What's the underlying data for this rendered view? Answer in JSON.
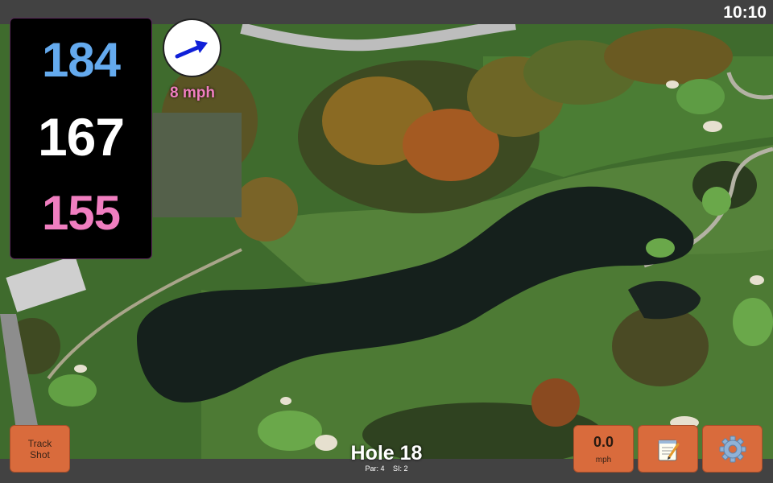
{
  "status": {
    "time": "10:10"
  },
  "distances": {
    "back": "184",
    "middle": "167",
    "front": "155"
  },
  "wind": {
    "speed": "8 mph",
    "icon": "arrow-northeast-icon"
  },
  "buttons": {
    "track_line1": "Track",
    "track_line2": "Shot",
    "speed_value": "0.0",
    "speed_unit": "mph",
    "notes_icon": "notepad-icon",
    "settings_icon": "gear-icon"
  },
  "hole": {
    "title": "Hole 18",
    "par": "Par: 4",
    "si": "SI: 2"
  },
  "colors": {
    "back": "#64aaee",
    "middle": "#ffffff",
    "front": "#f07ec0",
    "button": "#d96b3c",
    "bar": "#424242"
  }
}
